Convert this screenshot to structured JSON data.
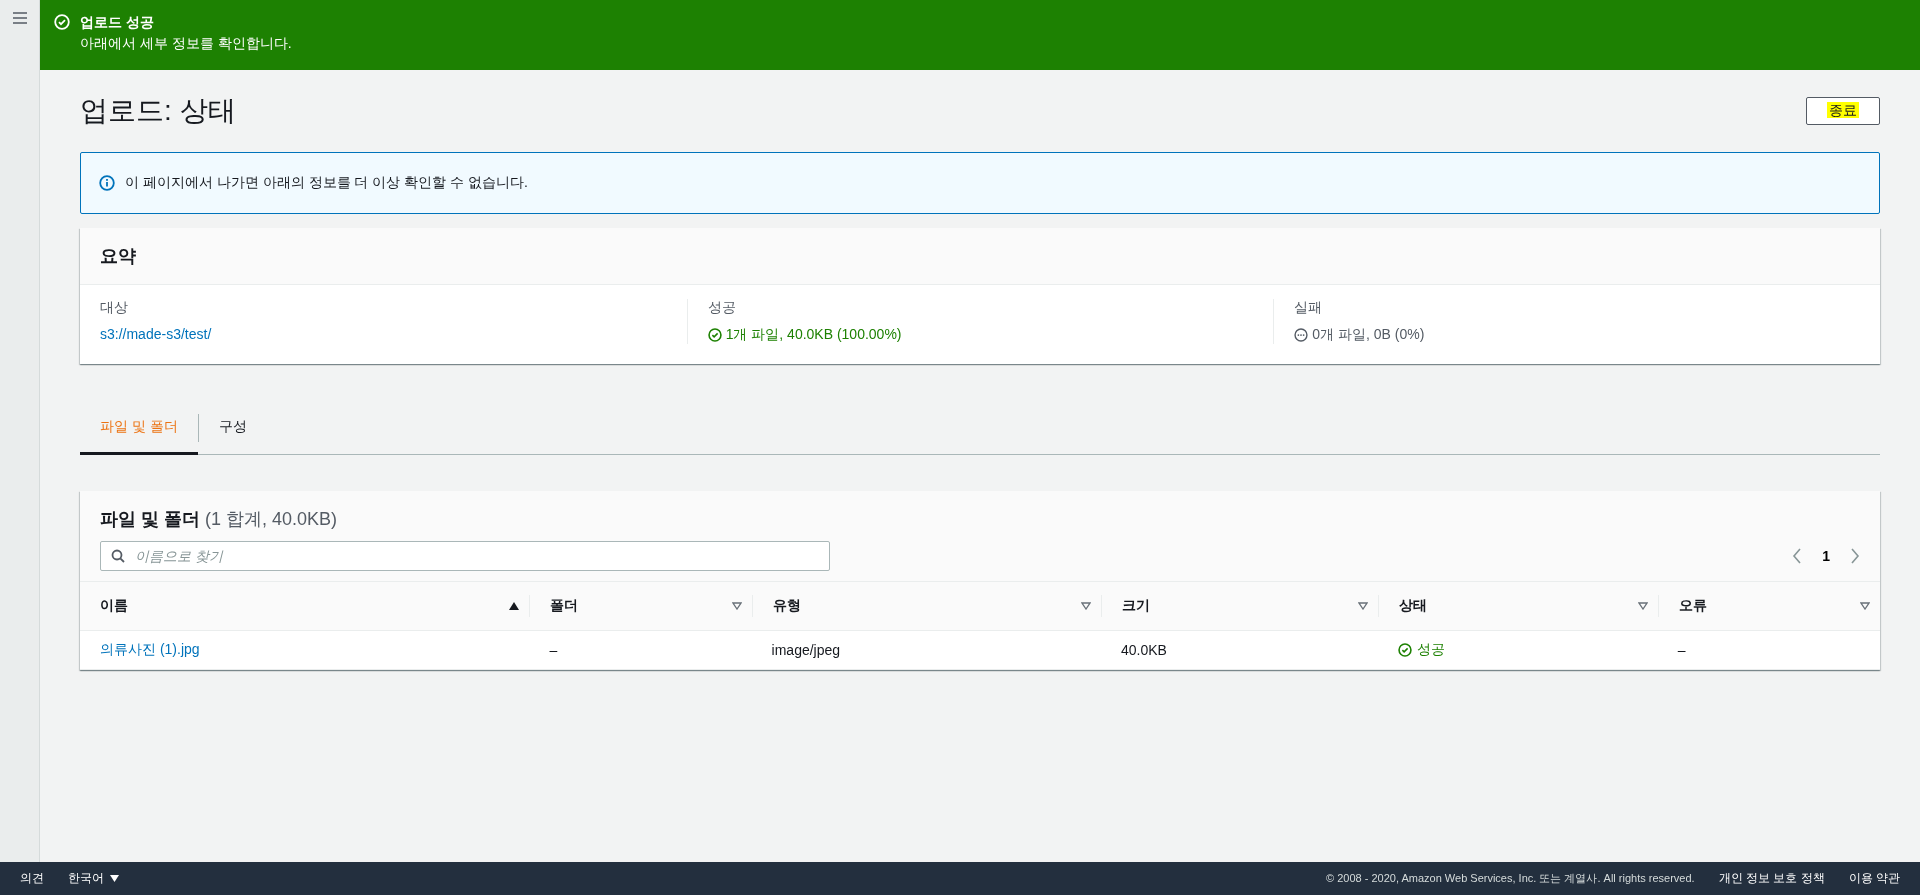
{
  "flash": {
    "title": "업로드 성공",
    "message": "아래에서 세부 정보를 확인합니다."
  },
  "page": {
    "title": "업로드: 상태",
    "close_button": {
      "label": "종료",
      "highlighted": true
    }
  },
  "info_alert": "이 페이지에서 나가면 아래의 정보를 더 이상 확인할 수 없습니다.",
  "summary": {
    "title": "요약",
    "items": [
      {
        "label": "대상",
        "value": "s3://made-s3/test/",
        "kind": "link"
      },
      {
        "label": "성공",
        "value": "1개 파일, 40.0KB (100.00%)",
        "kind": "success"
      },
      {
        "label": "실패",
        "value": "0개 파일, 0B (0%)",
        "kind": "neutral"
      }
    ]
  },
  "tabs": [
    {
      "label": "파일 및 폴더",
      "selected": true
    },
    {
      "label": "구성",
      "selected": false
    }
  ],
  "files": {
    "title": "파일 및 폴더",
    "count": "(1 합계, 40.0KB)",
    "search": {
      "placeholder": "이름으로 찾기"
    },
    "page": "1",
    "columns": [
      {
        "label": "이름",
        "sorted": true
      },
      {
        "label": "폴더",
        "sorted": false
      },
      {
        "label": "유형",
        "sorted": false
      },
      {
        "label": "크기",
        "sorted": false
      },
      {
        "label": "상태",
        "sorted": false
      },
      {
        "label": "오류",
        "sorted": false
      }
    ],
    "rows": [
      {
        "name": "의류사진 (1).jpg",
        "folder": "–",
        "type": "image/jpeg",
        "size": "40.0KB",
        "status": "성공",
        "error": "–"
      }
    ]
  },
  "footer": {
    "feedback": "의견",
    "language": "한국어",
    "copyright": "© 2008 - 2020, Amazon Web Services, Inc. 또는 계열사. All rights reserved.",
    "links": [
      "개인 정보 보호 정책",
      "이용 약관"
    ]
  }
}
